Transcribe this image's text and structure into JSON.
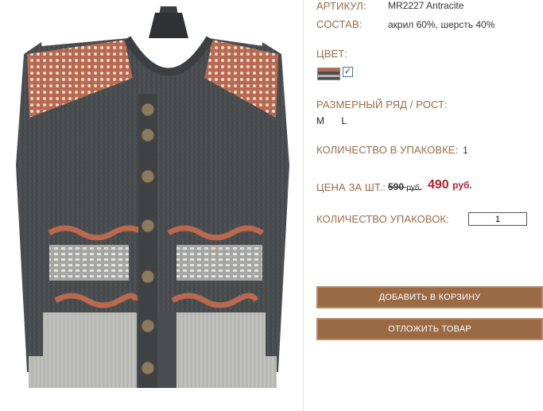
{
  "product": {
    "article_label": "АРТИКУЛ:",
    "article_value": "MR2227 Antracite",
    "composition_label": "СОСТАВ:",
    "composition_value": "акрил 60%, шерсть 40%",
    "color_label": "ЦВЕТ:",
    "color_checked": true,
    "size_label": "РАЗМЕРНЫЙ РЯД / РОСТ:",
    "sizes": [
      "M",
      "L"
    ],
    "pack_qty_label": "КОЛИЧЕСТВО В УПАКОВКЕ:",
    "pack_qty_value": "1",
    "price_label": "ЦЕНА ЗА ШТ.:",
    "old_price": "590",
    "old_price_currency": "руб.",
    "new_price": "490",
    "new_price_currency": "руб.",
    "packs_label": "КОЛИЧЕСТВО УПАКОВОК:",
    "packs_value": "1"
  },
  "actions": {
    "add_to_cart": "ДОБАВИТЬ В КОРЗИНУ",
    "postpone": "ОТЛОЖИТЬ ТОВАР"
  },
  "colors": {
    "accent_label": "#9b6a45",
    "button_bg": "#9a6a44",
    "price_red": "#b0212a",
    "sweater_body": "#4a4d4f",
    "sweater_accent": "#b9694f",
    "sweater_light": "#b3b3b0"
  }
}
